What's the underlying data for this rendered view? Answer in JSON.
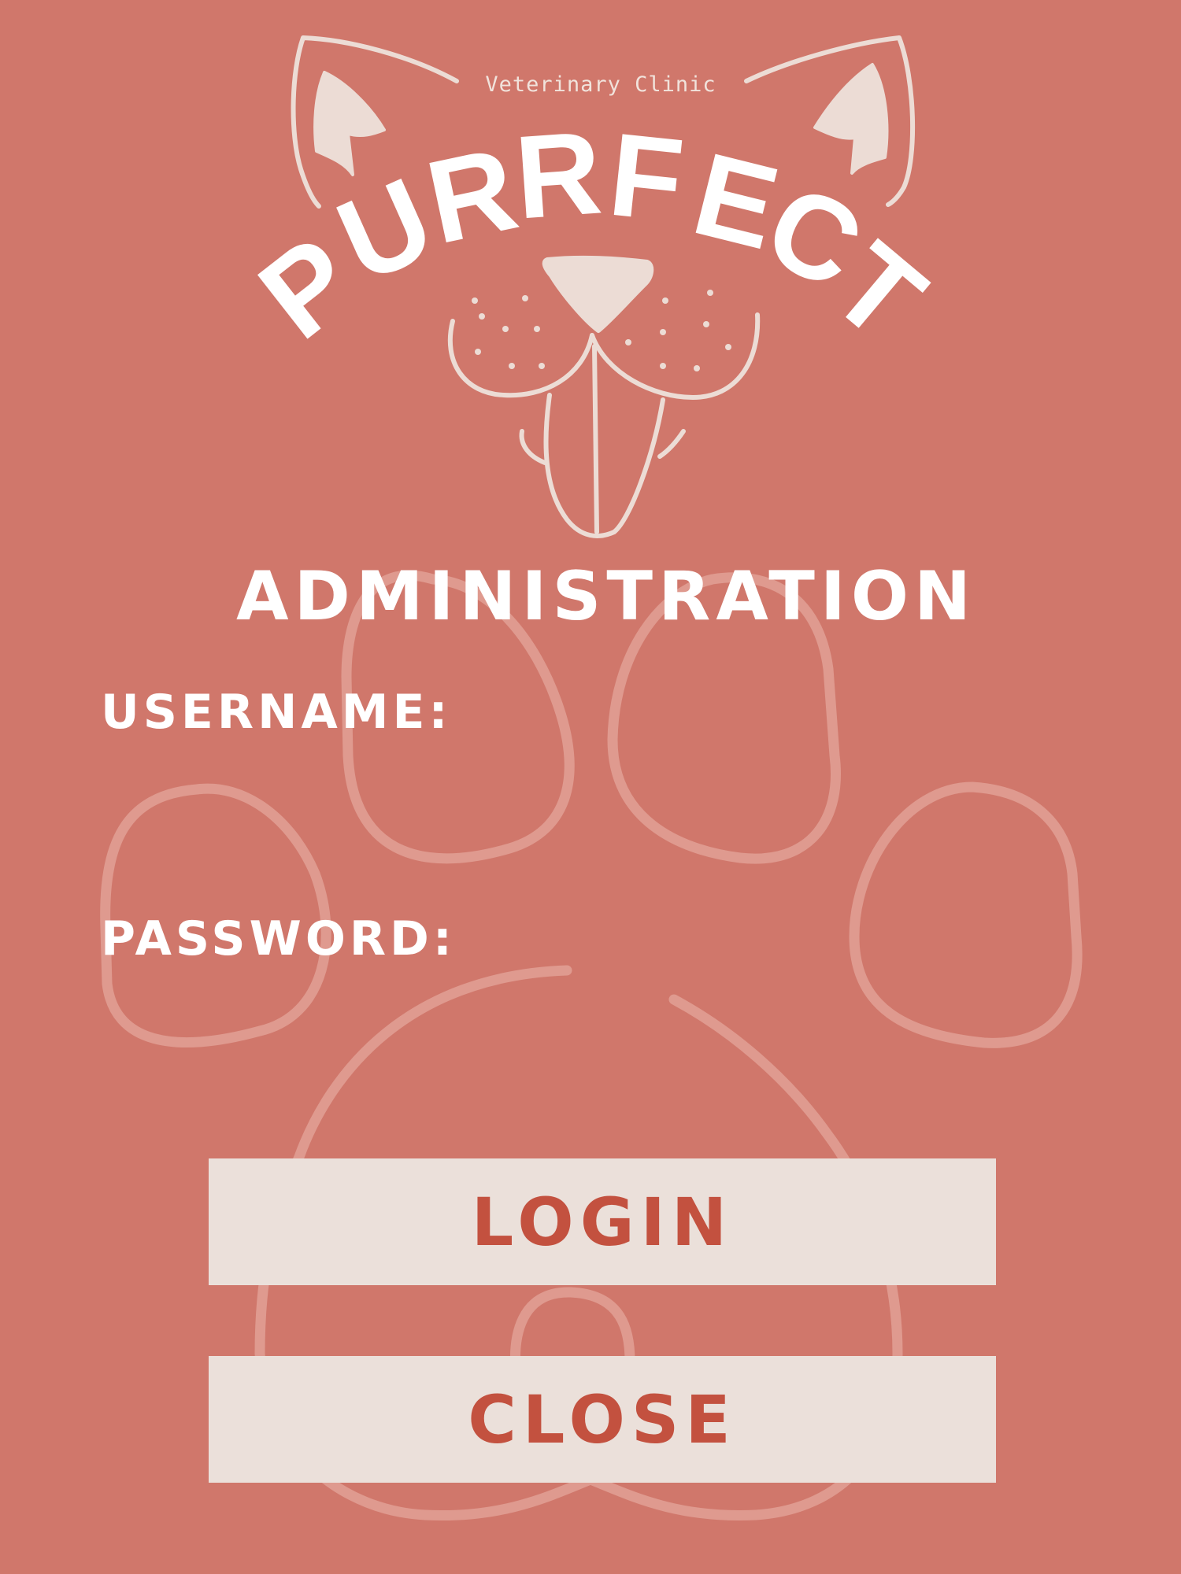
{
  "brand": {
    "tagline": "Veterinary Clinic",
    "letters": [
      "P",
      "U",
      "R",
      "R",
      "F",
      "E",
      "C",
      "T"
    ]
  },
  "page": {
    "heading": "ADMINISTRATION"
  },
  "form": {
    "username_label": "USERNAME:",
    "username_value": "",
    "password_label": "PASSWORD:",
    "password_value": ""
  },
  "actions": {
    "login_label": "LOGIN",
    "close_label": "CLOSE"
  },
  "colors": {
    "background": "#d0776b",
    "button_fill": "#ebe0da",
    "button_text": "#c3513f",
    "text": "#ffffff",
    "logo_line": "#f1e3dc"
  },
  "icons": [
    "cat-face-logo",
    "paw-print-background"
  ]
}
